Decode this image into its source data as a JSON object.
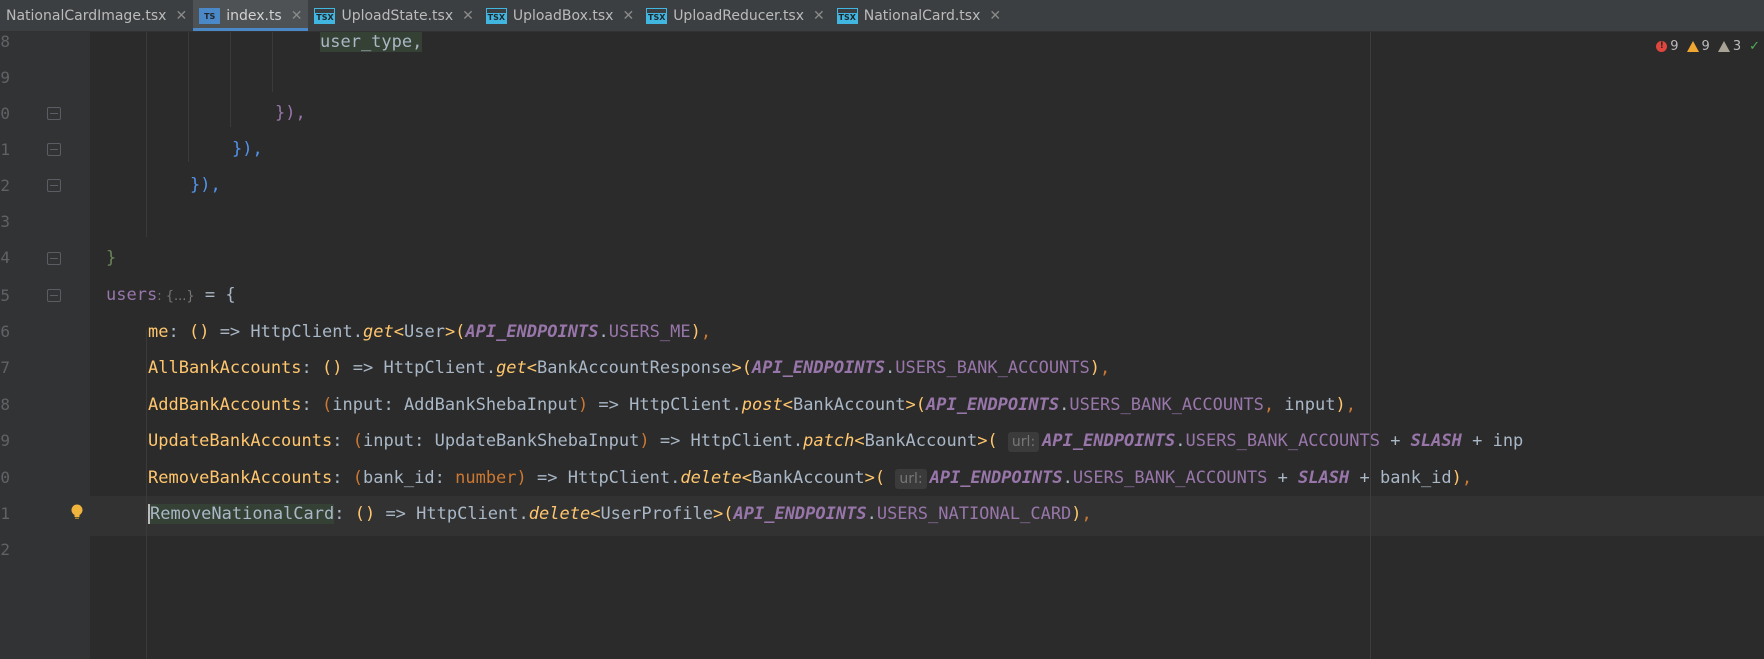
{
  "tabs": [
    {
      "label": "NationalCardImage.tsx",
      "icon": "none",
      "active": false
    },
    {
      "label": "index.ts",
      "icon": "ts",
      "active": true
    },
    {
      "label": "UploadState.tsx",
      "icon": "tsx",
      "active": false
    },
    {
      "label": "UploadBox.tsx",
      "icon": "tsx",
      "active": false
    },
    {
      "label": "UploadReducer.tsx",
      "icon": "tsx",
      "active": false
    },
    {
      "label": "NationalCard.tsx",
      "icon": "tsx",
      "active": false
    }
  ],
  "inspections": {
    "errors": "9",
    "warnings": "9",
    "weak_warnings": "3"
  },
  "line_numbers": [
    "8",
    "9",
    "0",
    "1",
    "2",
    "3",
    "4",
    "5",
    "6",
    "7",
    "8",
    "9",
    "0",
    "1",
    "2"
  ],
  "code": {
    "line8": "user_type,",
    "line10": "}),",
    "line11": "}),",
    "line12": "}),",
    "line14": "}",
    "line15_name": "users",
    "line15_hint": ": {...}",
    "line15_rest": " = {",
    "me_key": "me",
    "all_key": "AllBankAccounts",
    "add_key": "AddBankAccounts",
    "update_key": "UpdateBankAccounts",
    "remove_key": "RemoveBankAccounts",
    "removenc_key": "RemoveNationalCard",
    "httpclient": "HttpClient",
    "get": "get",
    "post": "post",
    "patch": "patch",
    "delete": "delete",
    "user_type": "User",
    "bank_account_response": "BankAccountResponse",
    "bank_account": "BankAccount",
    "user_profile": "UserProfile",
    "api_endpoints": "API_ENDPOINTS",
    "users_me": "USERS_ME",
    "users_bank_accounts": "USERS_BANK_ACCOUNTS",
    "users_national_card": "USERS_NATIONAL_CARD",
    "slash": "SLASH",
    "input": "input",
    "bank_id": "bank_id",
    "number": "number",
    "add_input_type": "AddBankShebaInput",
    "update_input_type": "UpdateBankShebaInput",
    "url_hint": "url:",
    "inp_trunc": "inp"
  }
}
